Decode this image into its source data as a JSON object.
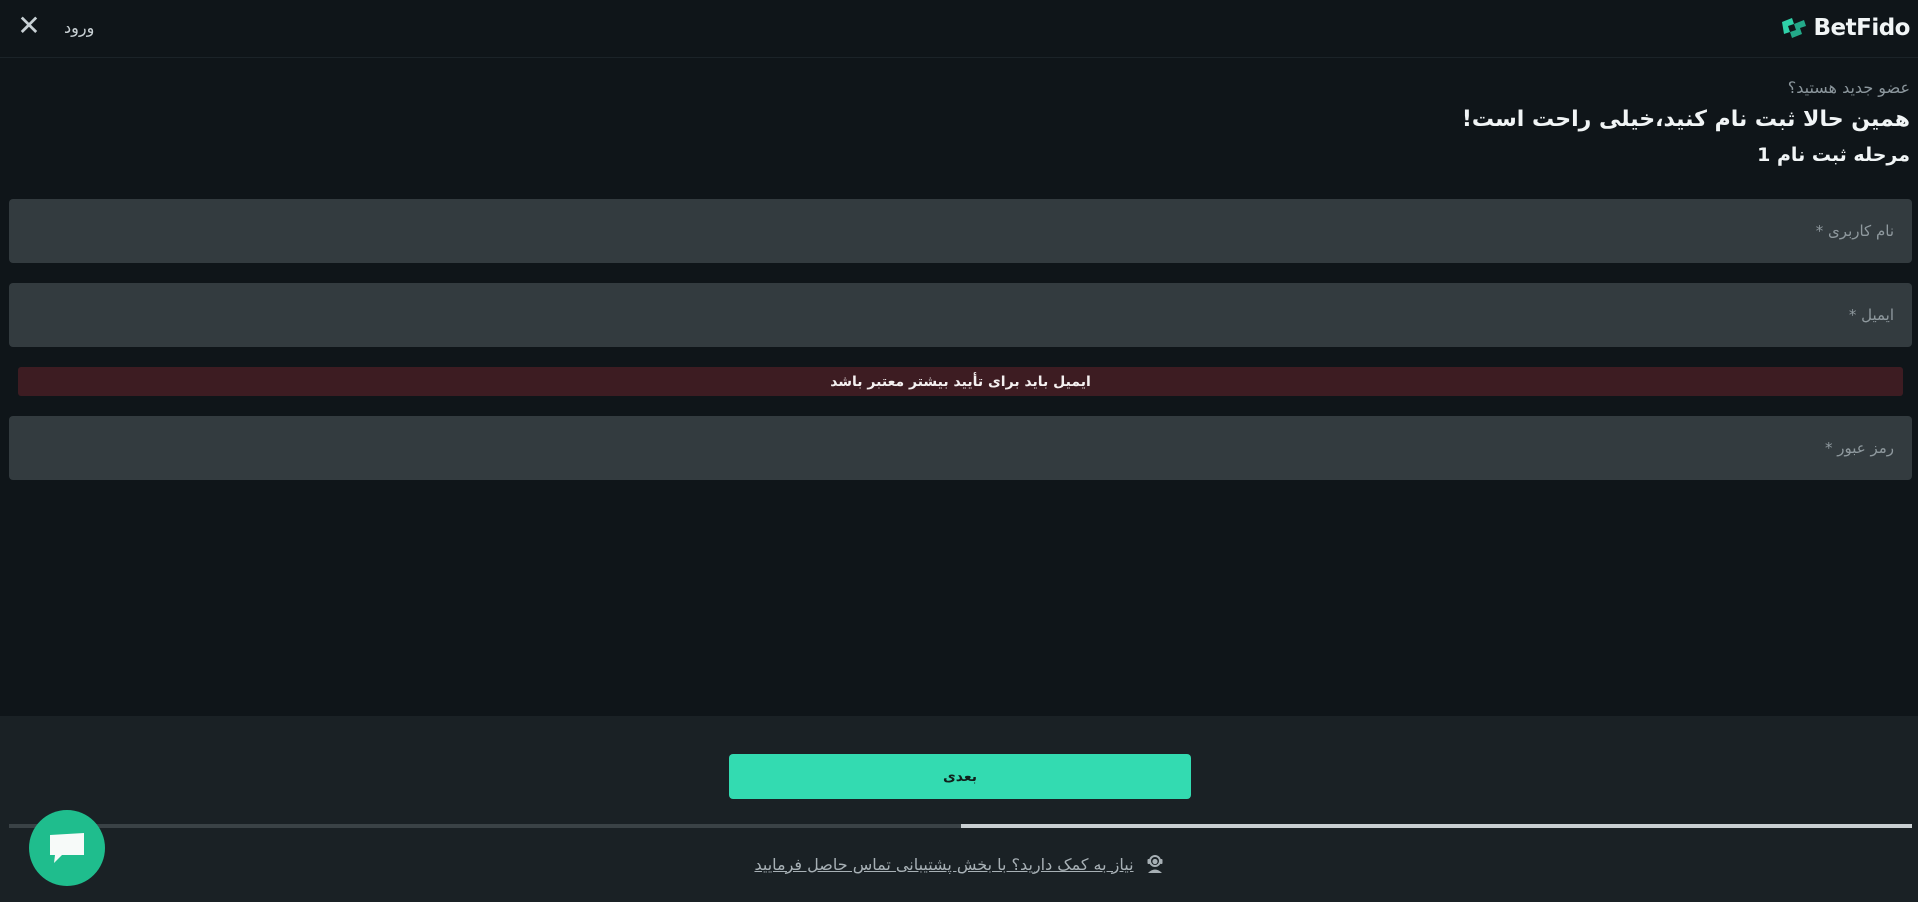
{
  "header": {
    "close_symbol": "✕",
    "login_label": "ورود",
    "logo_text": "BetFido"
  },
  "intro": {
    "subtitle": "عضو جدید هستید؟",
    "title": "همین حالا ثبت نام کنید،خیلی راحت است!",
    "step": "مرحله ثبت نام 1"
  },
  "form": {
    "username_placeholder": "نام کاربری *",
    "email_placeholder": "ایمیل *",
    "email_error": "ایمیل باید برای تأیید بیشتر معتبر باشد",
    "password_placeholder": "رمز عبور *"
  },
  "footer": {
    "next_label": "بعدی",
    "progress_fraction": 0.5,
    "support_text": "نیاز به کمک دارید؟ با بخش پشتیبانی تماس حاصل فرمایید"
  },
  "colors": {
    "accent": "#33dbb1",
    "chat_button": "#1fbd8d",
    "error_background": "#3d1c22",
    "background": "#0f1519"
  },
  "icons": {
    "close": "close-icon",
    "logo": "betfido-logo-icon",
    "support": "support-agent-icon",
    "chat": "chat-bubble-icon"
  }
}
